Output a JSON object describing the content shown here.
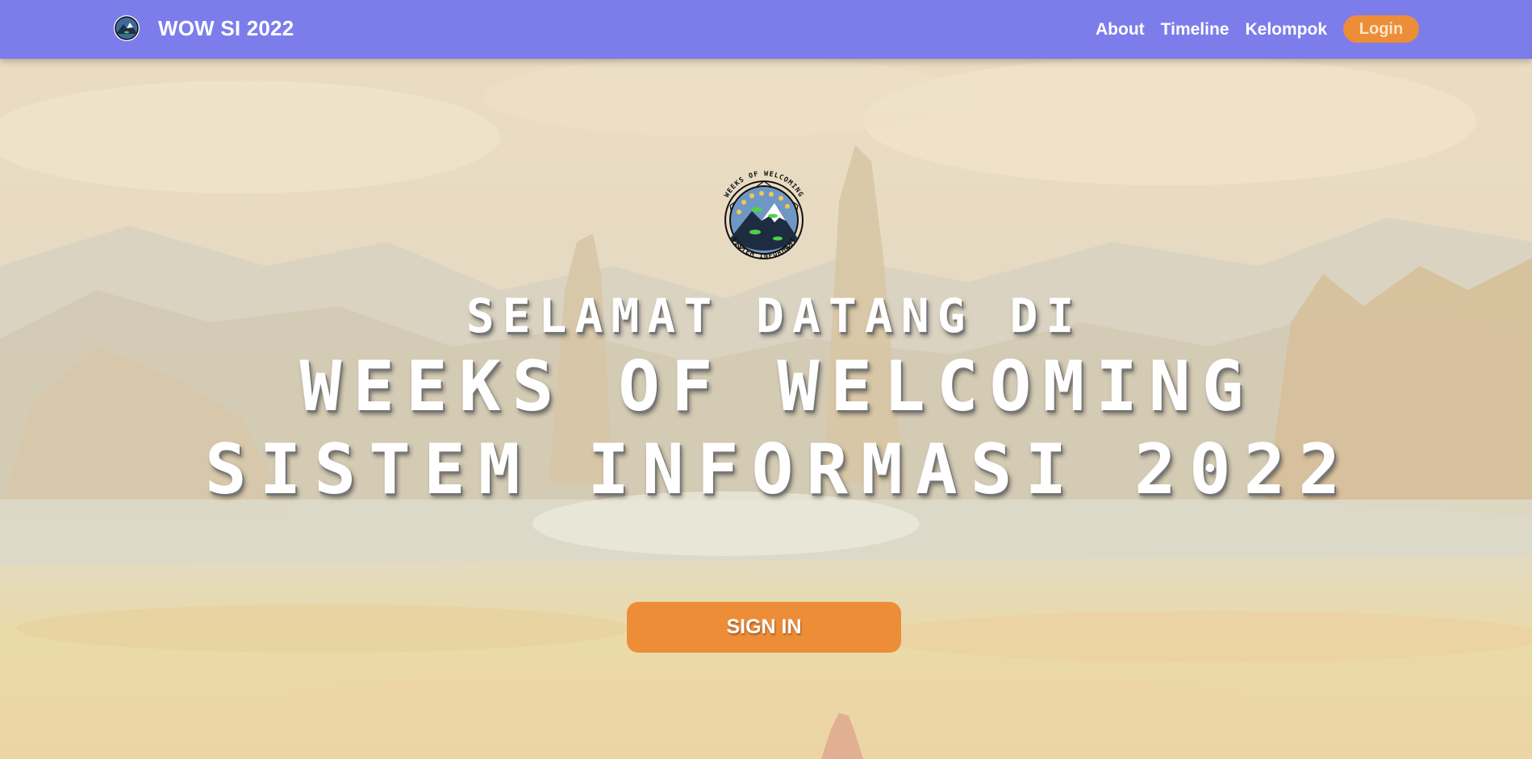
{
  "navbar": {
    "brand_logo_icon": "wow-si-emblem-icon",
    "brand_title": "WOW SI 2022",
    "links": [
      {
        "label": "About"
      },
      {
        "label": "Timeline"
      },
      {
        "label": "Kelompok"
      }
    ],
    "login_label": "Login",
    "background_color": "#7c7deb",
    "accent_color": "#ee8d38"
  },
  "hero": {
    "emblem": {
      "icon": "wow-si-emblem-icon",
      "top_text": "WEEKS OF WELCOMING",
      "bottom_text": "SISTEM INFORMASI"
    },
    "welcome_line": "SELAMAT DATANG DI",
    "title_line_1": "WEEKS OF WELCOMING",
    "title_line_2": "SISTEM INFORMASI 2022",
    "signin_label": "SIGN IN",
    "background_image": "painted-mountain-valley-landscape"
  }
}
